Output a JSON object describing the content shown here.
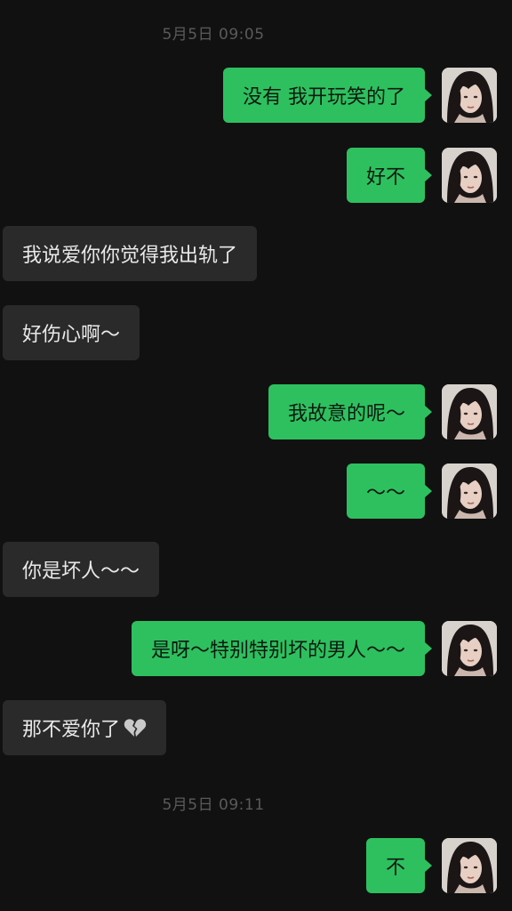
{
  "timestamps": [
    "5月5日 09:05",
    "5月5日 09:11"
  ],
  "messages": [
    {
      "side": "sent",
      "text": "没有 我开玩笑的了"
    },
    {
      "side": "sent",
      "text": "好不"
    },
    {
      "side": "received",
      "text": "我说爱你你觉得我出轨了"
    },
    {
      "side": "received",
      "text": "好伤心啊～"
    },
    {
      "side": "sent",
      "text": "我故意的呢～"
    },
    {
      "side": "sent",
      "text": "～～"
    },
    {
      "side": "received",
      "text": "你是坏人～～"
    },
    {
      "side": "sent",
      "text": "是呀～特别特别坏的男人～～"
    },
    {
      "side": "received",
      "text": "那不爱你了",
      "emoji": "broken-heart-icon"
    },
    {
      "side": "sent",
      "text": "不"
    }
  ],
  "colors": {
    "background": "#111111",
    "sent_bubble": "#2ec05f",
    "received_bubble": "#2a2a2a",
    "timestamp_text": "#5a5a5a"
  }
}
